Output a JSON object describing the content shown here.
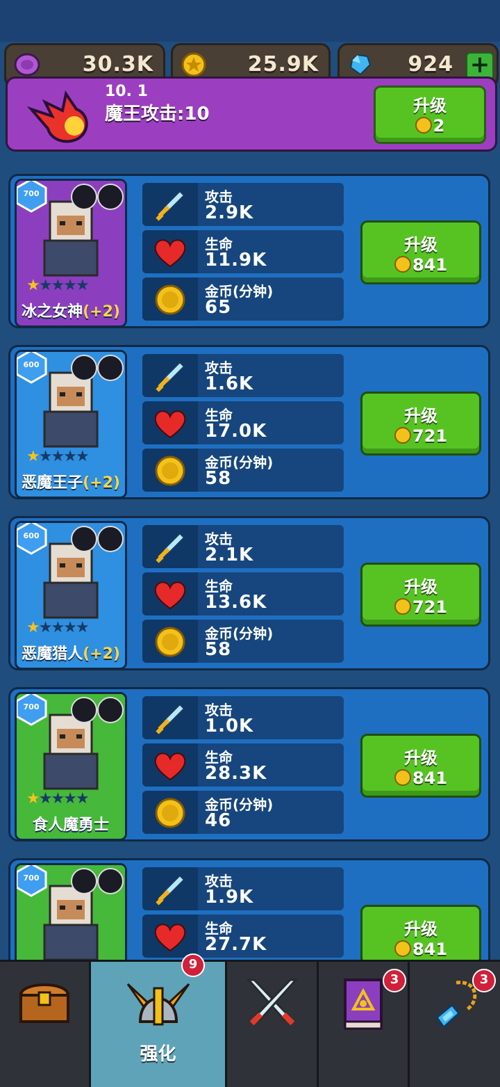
{
  "resources": {
    "orb": "30.3K",
    "coin": "25.9K",
    "gem": "924",
    "add_symbol": "+"
  },
  "boss": {
    "level": "10. 1",
    "attack": "魔王攻击:10",
    "upgrade_label": "升级",
    "upgrade_cost": "2"
  },
  "stat_labels": {
    "attack": "攻击",
    "hp": "生命",
    "coin": "金币(分钟)"
  },
  "upgrade_label": "升级",
  "heroes": [
    {
      "power": "700",
      "name": "冰之女神",
      "bonus": "(+2)",
      "stars": 1,
      "attack": "2.9K",
      "hp": "11.9K",
      "coin": "65",
      "cost": "841"
    },
    {
      "power": "600",
      "name": "恶魔王子",
      "bonus": "(+2)",
      "stars": 1,
      "attack": "1.6K",
      "hp": "17.0K",
      "coin": "58",
      "cost": "721"
    },
    {
      "power": "600",
      "name": "恶魔猎人",
      "bonus": "(+2)",
      "stars": 1,
      "attack": "2.1K",
      "hp": "13.6K",
      "coin": "58",
      "cost": "721"
    },
    {
      "power": "700",
      "name": "食人魔勇士",
      "bonus": "",
      "stars": 1,
      "attack": "1.0K",
      "hp": "28.3K",
      "coin": "46",
      "cost": "841"
    },
    {
      "power": "700",
      "name": "",
      "bonus": "",
      "stars": 1,
      "attack": "1.9K",
      "hp": "27.7K",
      "coin": "",
      "cost": "841"
    }
  ],
  "nav": {
    "tabs": [
      {
        "icon": "treasure-chest-icon",
        "label": "",
        "badge": ""
      },
      {
        "icon": "winged-helmet-icon",
        "label": "强化",
        "badge": "9"
      },
      {
        "icon": "crossed-swords-icon",
        "label": "",
        "badge": ""
      },
      {
        "icon": "spellbook-icon",
        "label": "",
        "badge": "3"
      },
      {
        "icon": "amulet-icon",
        "label": "",
        "badge": "3"
      }
    ]
  },
  "colors": {
    "background": "#1f4d7e",
    "panel": "#1e6fc2",
    "button_green": "#56c323",
    "boss_purple": "#9b3fc0",
    "nav_active": "#5fa3b9"
  }
}
